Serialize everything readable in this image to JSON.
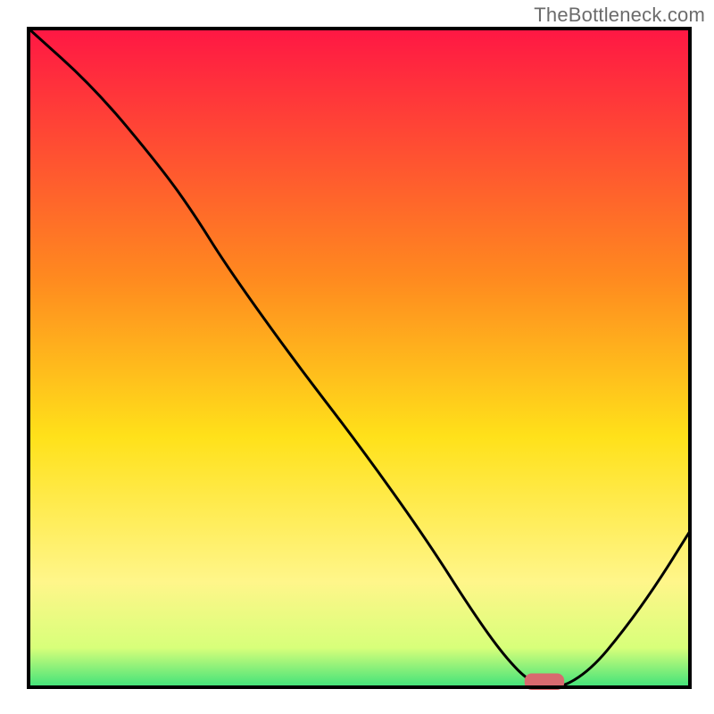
{
  "watermark": "TheBottleneck.com",
  "colors": {
    "gradient": [
      "#ff1744",
      "#ff8a1f",
      "#ffe11a",
      "#fff68a",
      "#d8ff7a",
      "#3fe27a"
    ],
    "curve": "#000000",
    "marker": "#d86a6f",
    "axes": "#000000"
  },
  "chart_data": {
    "type": "line",
    "title": "",
    "xlabel": "",
    "ylabel": "",
    "xlim": [
      0,
      100
    ],
    "ylim": [
      0,
      100
    ],
    "x": [
      0,
      10,
      20,
      25,
      30,
      40,
      50,
      60,
      67,
      72,
      76,
      80,
      85,
      90,
      95,
      100
    ],
    "values": [
      100,
      91,
      79,
      72,
      64,
      50,
      37,
      23,
      12,
      5,
      1,
      0,
      3,
      9,
      16,
      24
    ],
    "marker": {
      "x_start": 75,
      "x_end": 81,
      "y": 0,
      "height": 2.5
    },
    "annotations": []
  }
}
